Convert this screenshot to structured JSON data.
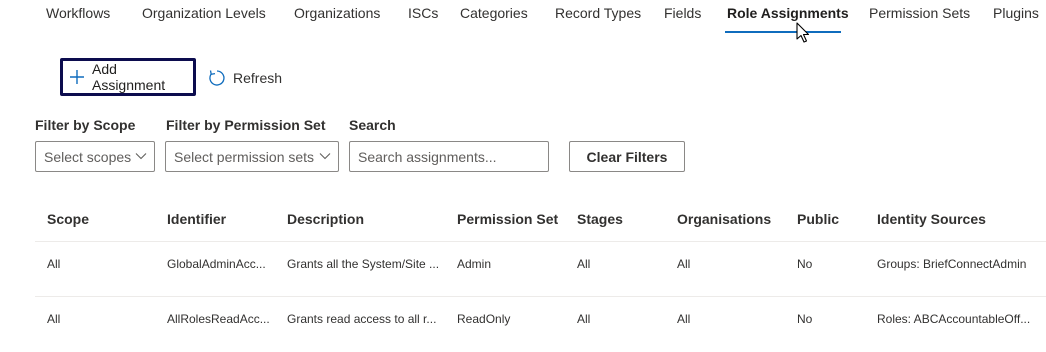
{
  "tabs": [
    {
      "label": "Workflows"
    },
    {
      "label": "Organization Levels"
    },
    {
      "label": "Organizations"
    },
    {
      "label": "ISCs"
    },
    {
      "label": "Categories"
    },
    {
      "label": "Record Types"
    },
    {
      "label": "Fields"
    },
    {
      "label": "Role Assignments",
      "active": true
    },
    {
      "label": "Permission Sets"
    },
    {
      "label": "Plugins"
    }
  ],
  "toolbar": {
    "add_label": "Add Assignment",
    "refresh_label": "Refresh"
  },
  "filters": {
    "scope_label": "Filter by Scope",
    "scope_placeholder": "Select scopes",
    "permset_label": "Filter by Permission Set",
    "permset_placeholder": "Select permission sets",
    "search_label": "Search",
    "search_placeholder": "Search assignments...",
    "clear_label": "Clear Filters"
  },
  "table": {
    "columns": [
      "Scope",
      "Identifier",
      "Description",
      "Permission Set",
      "Stages",
      "Organisations",
      "Public",
      "Identity Sources"
    ],
    "rows": [
      [
        "All",
        "GlobalAdminAcc...",
        "Grants all the System/Site ...",
        "Admin",
        "All",
        "All",
        "No",
        "Groups: BriefConnectAdmin"
      ],
      [
        "All",
        "AllRolesReadAcc...",
        "Grants read access to all r...",
        "ReadOnly",
        "All",
        "All",
        "No",
        "Roles: ABCAccountableOff..."
      ]
    ]
  },
  "colors": {
    "accent": "#0f6cbd",
    "focus_border": "#0c0c4e",
    "border": "#8a8886"
  },
  "icons": {
    "add": "plus-icon",
    "refresh": "refresh-icon",
    "dropdown": "chevron-down-icon",
    "pointer": "mouse-cursor-icon"
  }
}
